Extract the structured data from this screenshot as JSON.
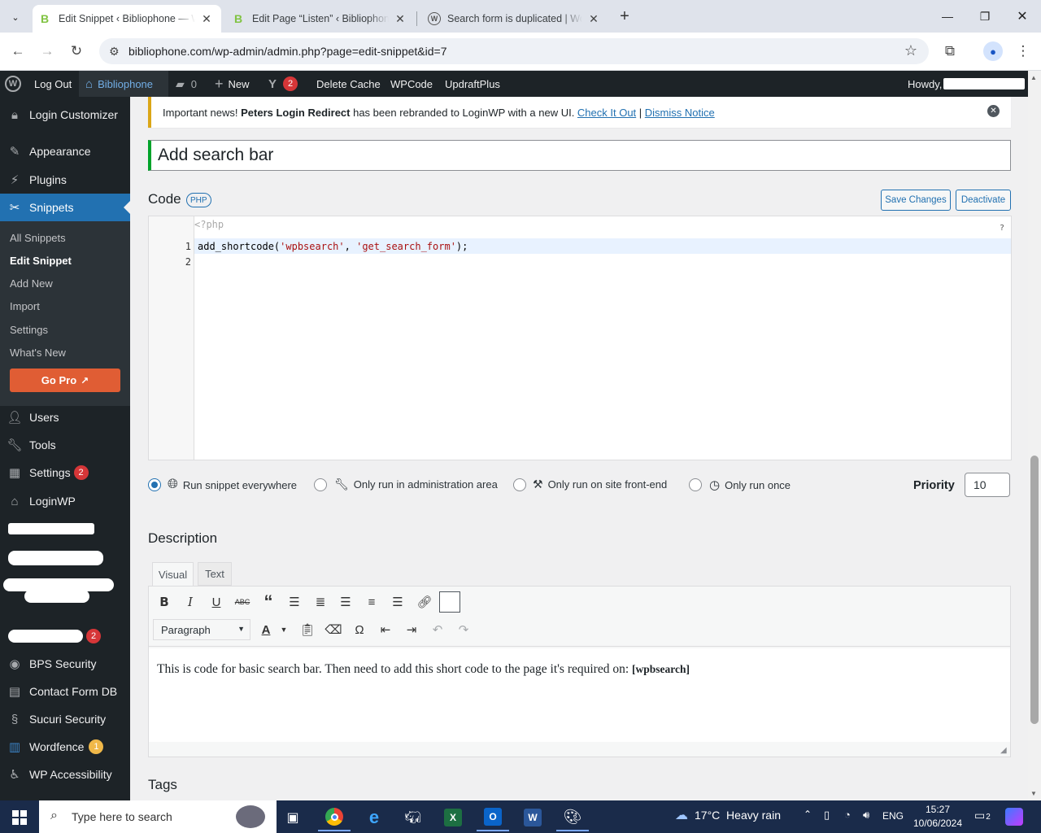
{
  "browser": {
    "tabs": [
      {
        "title": "Edit Snippet ‹ Bibliophone — W",
        "active": true,
        "favicon": "b-icon"
      },
      {
        "title": "Edit Page “Listen” ‹ Bibliophone",
        "active": false,
        "favicon": "b-icon"
      },
      {
        "title": "Search form is duplicated | Wor",
        "active": false,
        "favicon": "wordpress-icon"
      }
    ],
    "url": "bibliophone.com/wp-admin/admin.php?page=edit-snippet&id=7"
  },
  "adminbar": {
    "logout": "Log Out",
    "site": "Bibliophone",
    "comments_count": "0",
    "new": "New",
    "yoast_count": "2",
    "delete_cache": "Delete Cache",
    "wpcode": "WPCode",
    "updraft": "UpdraftPlus",
    "howdy": "Howdy,"
  },
  "sidebar": {
    "login_customizer": "Login Customizer",
    "appearance": "Appearance",
    "plugins": "Plugins",
    "snippets": "Snippets",
    "sub": [
      "All Snippets",
      "Edit Snippet",
      "Add New",
      "Import",
      "Settings",
      "What's New"
    ],
    "go_pro": "Go Pro",
    "users": "Users",
    "tools": "Tools",
    "settings": "Settings",
    "settings_count": "2",
    "loginwp": "LoginWP",
    "redacted_count": "2",
    "bps": "BPS Security",
    "cfdb": "Contact Form DB",
    "sucuri": "Sucuri Security",
    "wordfence": "Wordfence",
    "wordfence_count": "1",
    "wpa": "WP Accessibility"
  },
  "notice": {
    "prefix": "Important news! ",
    "bold": "Peters Login Redirect",
    "middle": " has been rebranded to LoginWP with a new UI. ",
    "link1": "Check It Out",
    "sep": " | ",
    "link2": "Dismiss Notice"
  },
  "snippet": {
    "title": "Add search bar",
    "code_label": "Code",
    "lang_badge": "PHP",
    "save": "Save Changes",
    "deactivate": "Deactivate",
    "php_open": "<?php",
    "help": "?",
    "line1_num": "1",
    "line2_num": "2",
    "code_fn": "add_shortcode(",
    "code_arg1": "'wpbsearch'",
    "code_sep": ", ",
    "code_arg2": "'get_search_form'",
    "code_end": ");"
  },
  "scope": {
    "options": [
      "Run snippet everywhere",
      "Only run in administration area",
      "Only run on site front-end",
      "Only run once"
    ],
    "selected": "Run snippet everywhere",
    "priority_label": "Priority",
    "priority_value": "10"
  },
  "description": {
    "heading": "Description",
    "tab_visual": "Visual",
    "tab_text": "Text",
    "format": "Paragraph",
    "body_text": "This is code for basic search bar. Then need to add this short code to the page it's required on: ",
    "body_code": "[wpbsearch]"
  },
  "tags": {
    "heading": "Tags"
  },
  "taskbar": {
    "search_placeholder": "Type here to search",
    "weather": "17°C  Heavy rain",
    "lang": "ENG",
    "time": "15:27",
    "date": "10/06/2024",
    "notif_count": "2"
  },
  "colors": {
    "wp_blue": "#2271b1",
    "admin_dark": "#1d2327",
    "active_menu": "#2271b1",
    "go_pro": "#e05d34"
  }
}
